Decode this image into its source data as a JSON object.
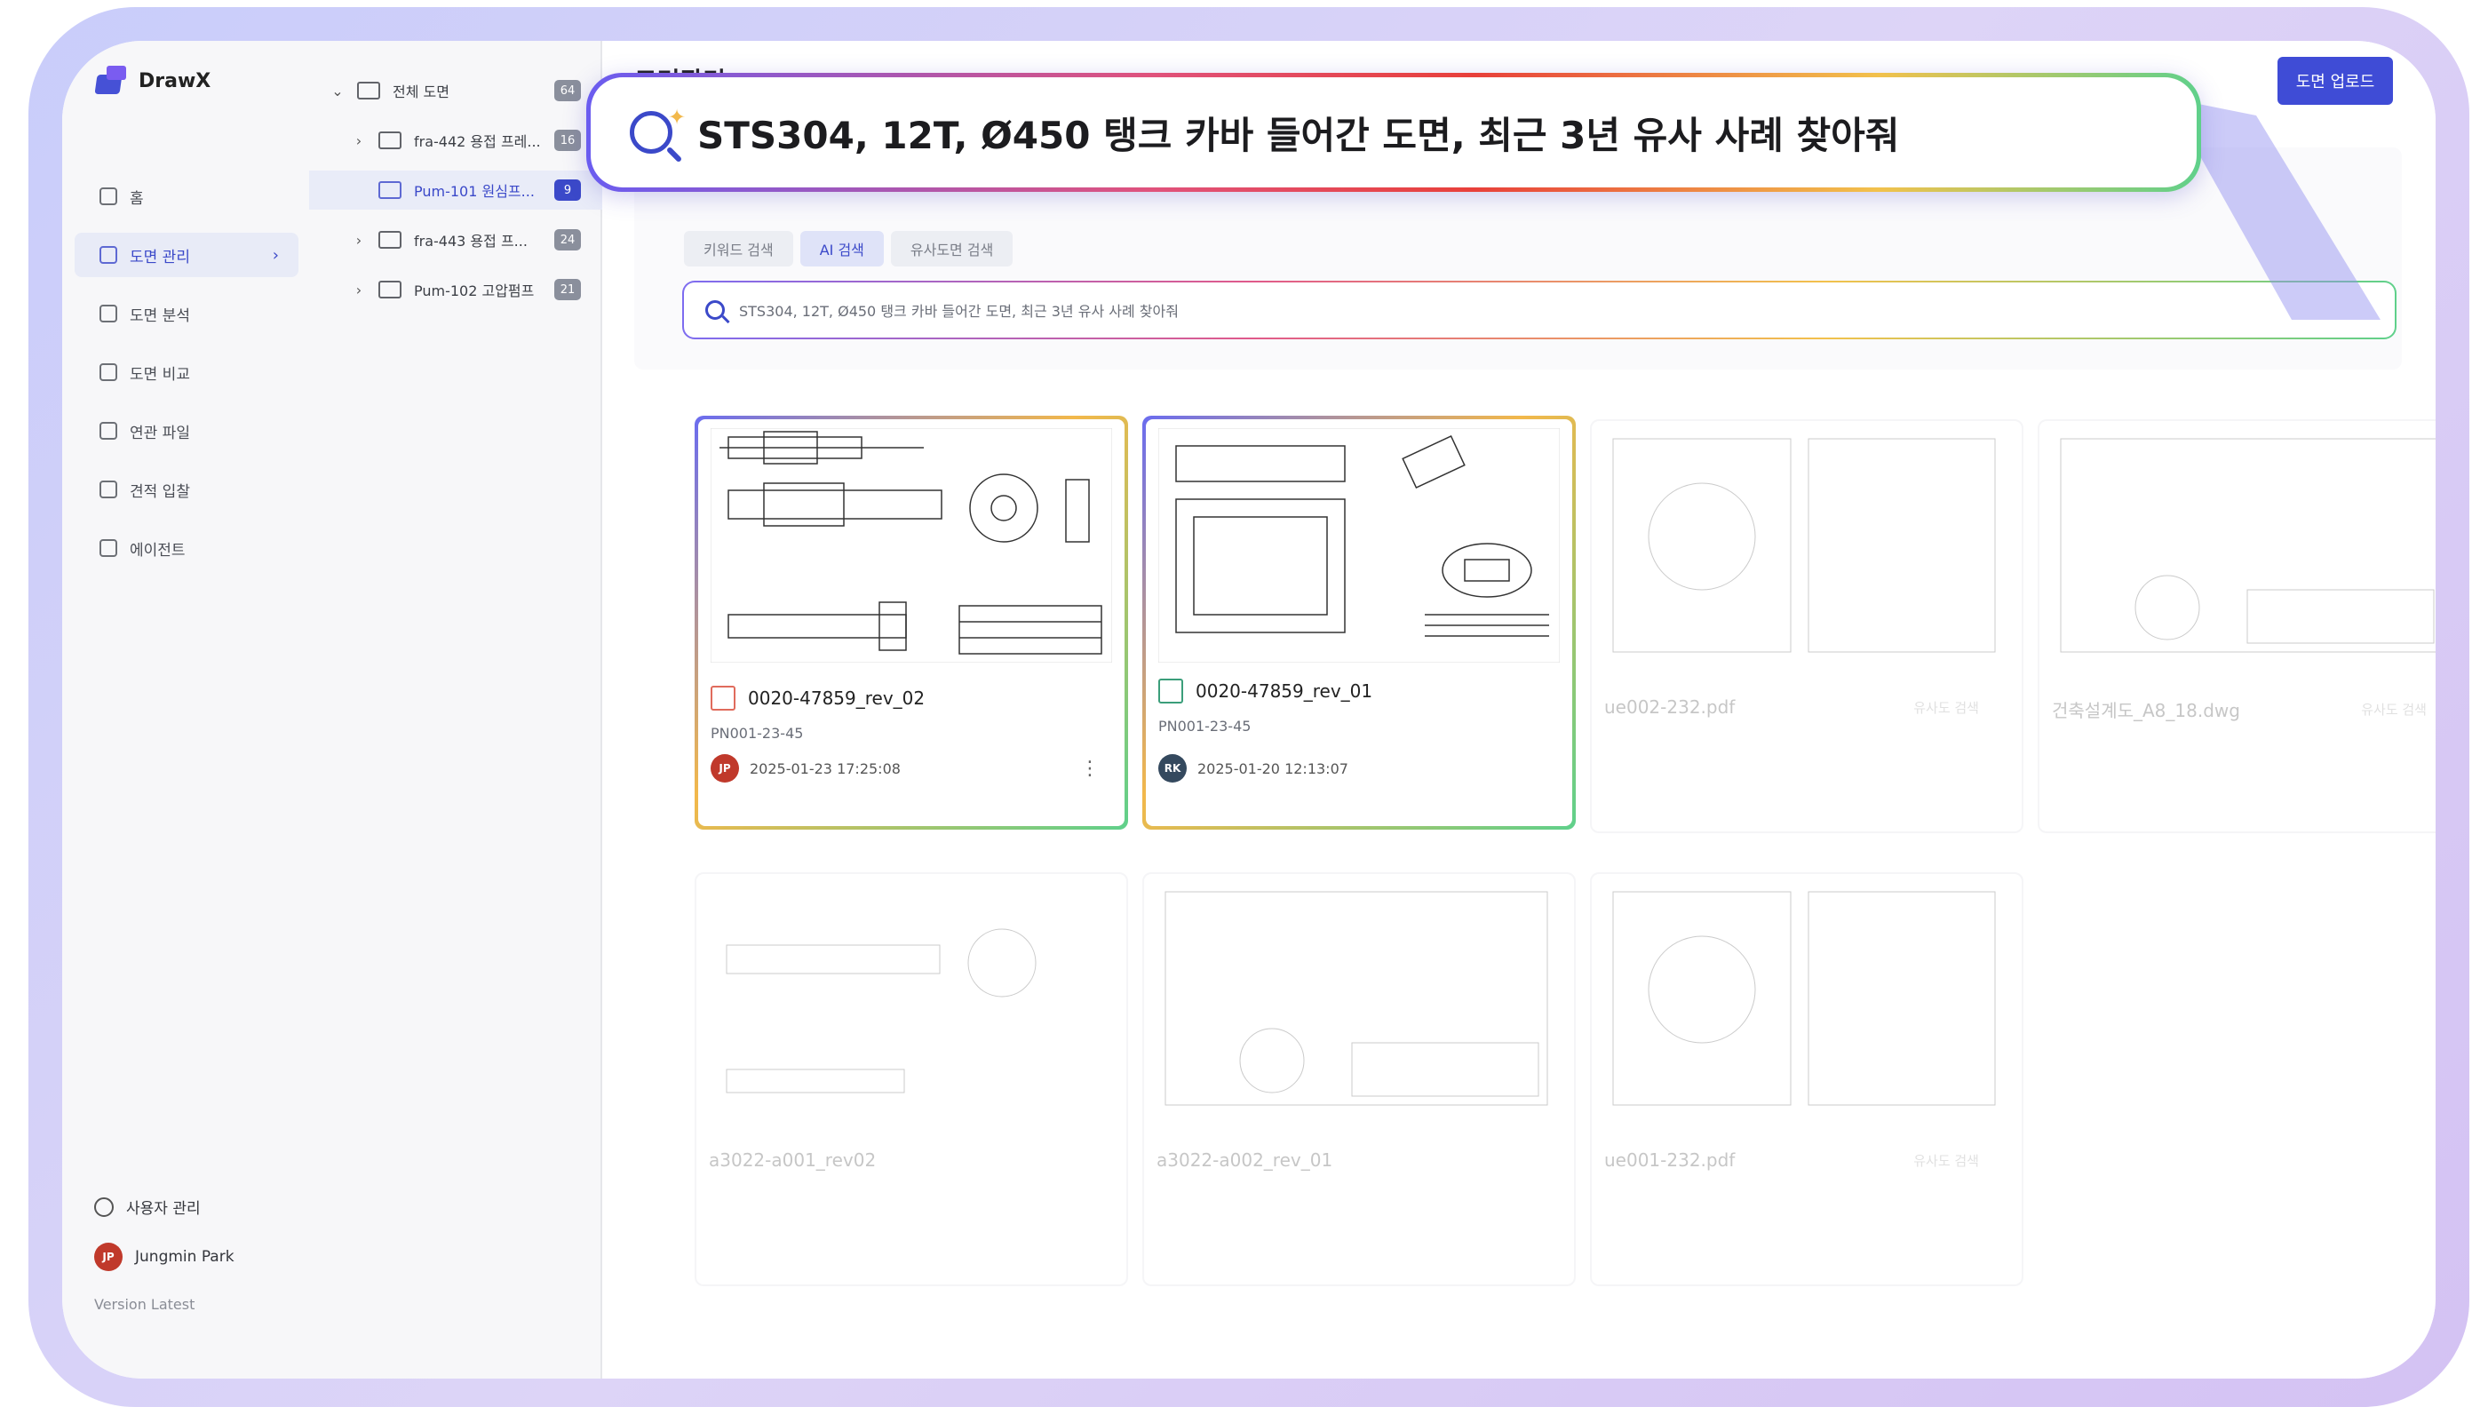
{
  "app": {
    "name": "DrawX",
    "trademark": "™"
  },
  "header": {
    "title": "도면관리",
    "upload_label": "도면 업로드"
  },
  "nav": {
    "items": [
      {
        "label": "홈",
        "icon": "home-icon"
      },
      {
        "label": "도면 관리",
        "icon": "folder-icon",
        "active": true
      },
      {
        "label": "도면 분석",
        "icon": "analysis-icon"
      },
      {
        "label": "도면 비교",
        "icon": "compare-icon"
      },
      {
        "label": "연관 파일",
        "icon": "file-icon"
      },
      {
        "label": "견적 입찰",
        "icon": "quote-icon"
      },
      {
        "label": "에이전트",
        "icon": "cube-icon"
      }
    ],
    "user_admin": "사용자 관리",
    "user": {
      "name": "Jungmin Park",
      "initials": "JP"
    },
    "version": "Version Latest"
  },
  "tree": [
    {
      "label": "전체 도면",
      "count": "64",
      "expanded": true
    },
    {
      "label": "fra-442 용접 프레...",
      "count": "16"
    },
    {
      "label": "Pum-101 원심프...",
      "count": "9",
      "active": true
    },
    {
      "label": "fra-443 용접 프...",
      "count": "24"
    },
    {
      "label": "Pum-102 고압펌프",
      "count": "21"
    }
  ],
  "search": {
    "tabs": [
      "키워드 검색",
      "AI 검색",
      "유사도면 검색"
    ],
    "active_tab": "AI 검색",
    "query": "STS304, 12T, Ø450 탱크 카바 들어간 도면, 최근 3년 유사 사례 찾아줘"
  },
  "cards": [
    {
      "name": "0020-47859_rev_02",
      "pn": "PN001-23-45",
      "date": "2025-01-23 17:25:08",
      "user": "JP",
      "user_color": "#c0392b",
      "type": "pdf"
    },
    {
      "name": "0020-47859_rev_01",
      "pn": "PN001-23-45",
      "date": "2025-01-20 12:13:07",
      "user": "RK",
      "user_color": "#34495e",
      "type": "image"
    },
    {
      "name": "ue002-232.pdf",
      "pn": "",
      "date": "",
      "sim": "유사도 검색"
    },
    {
      "name": "건축설계도_A8_18.dwg",
      "pn": "",
      "date": "",
      "sim": "유사도 검색"
    },
    {
      "name": "a3022-a001_rev02",
      "pn": "",
      "date": ""
    },
    {
      "name": "a3022-a002_rev_01",
      "pn": "",
      "date": ""
    },
    {
      "name": "ue001-232.pdf",
      "pn": "",
      "date": "",
      "sim": "유사도 검색"
    }
  ],
  "colors": {
    "accent": "#3f4cd6",
    "frame": "#d4c2f3"
  }
}
